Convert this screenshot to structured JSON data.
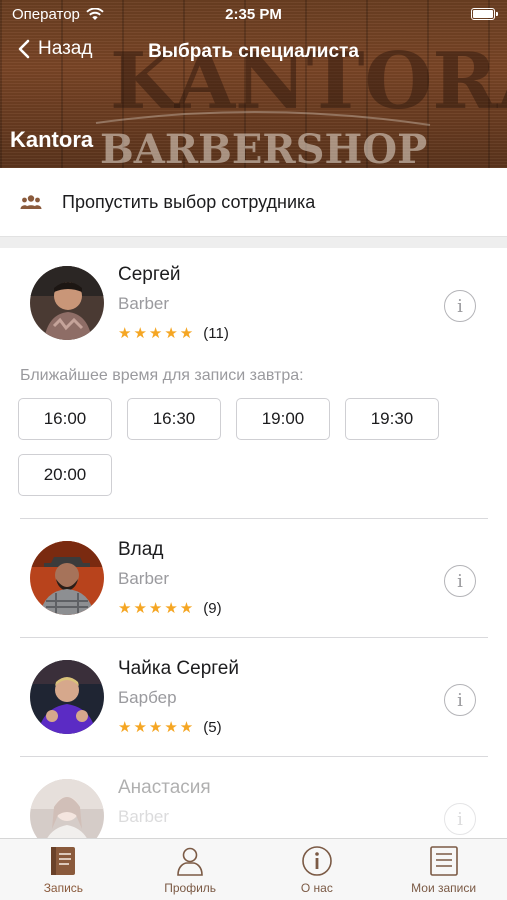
{
  "status_bar": {
    "carrier": "Оператор",
    "time": "2:35 PM"
  },
  "nav": {
    "back_label": "Назад",
    "title": "Выбрать специалиста"
  },
  "shop": {
    "name": "Kantora",
    "sign_top": "KANTORA",
    "sign_bottom": "BARBERSHOP"
  },
  "skip": {
    "label": "Пропустить выбор сотрудника"
  },
  "specialists": [
    {
      "name": "Сергей",
      "role": "Barber",
      "stars": "★★★★★",
      "reviews": "(11)",
      "nearest_label": "Ближайшее время для записи завтра:",
      "slots": [
        "16:00",
        "16:30",
        "19:00",
        "19:30",
        "20:00"
      ]
    },
    {
      "name": "Влад",
      "role": "Barber",
      "stars": "★★★★★",
      "reviews": "(9)"
    },
    {
      "name": "Чайка Сергей",
      "role": "Барбер",
      "stars": "★★★★★",
      "reviews": "(5)"
    },
    {
      "name": "Анастасия",
      "role": "Barber"
    }
  ],
  "tabs": [
    {
      "label": "Запись",
      "icon": "book-icon",
      "active": true
    },
    {
      "label": "Профиль",
      "icon": "person-icon",
      "active": false
    },
    {
      "label": "О нас",
      "icon": "info-icon",
      "active": false
    },
    {
      "label": "Мои записи",
      "icon": "list-icon",
      "active": false
    }
  ],
  "colors": {
    "accent": "#8a5a3c",
    "star": "#f5a623",
    "muted": "#9a9a9e"
  }
}
